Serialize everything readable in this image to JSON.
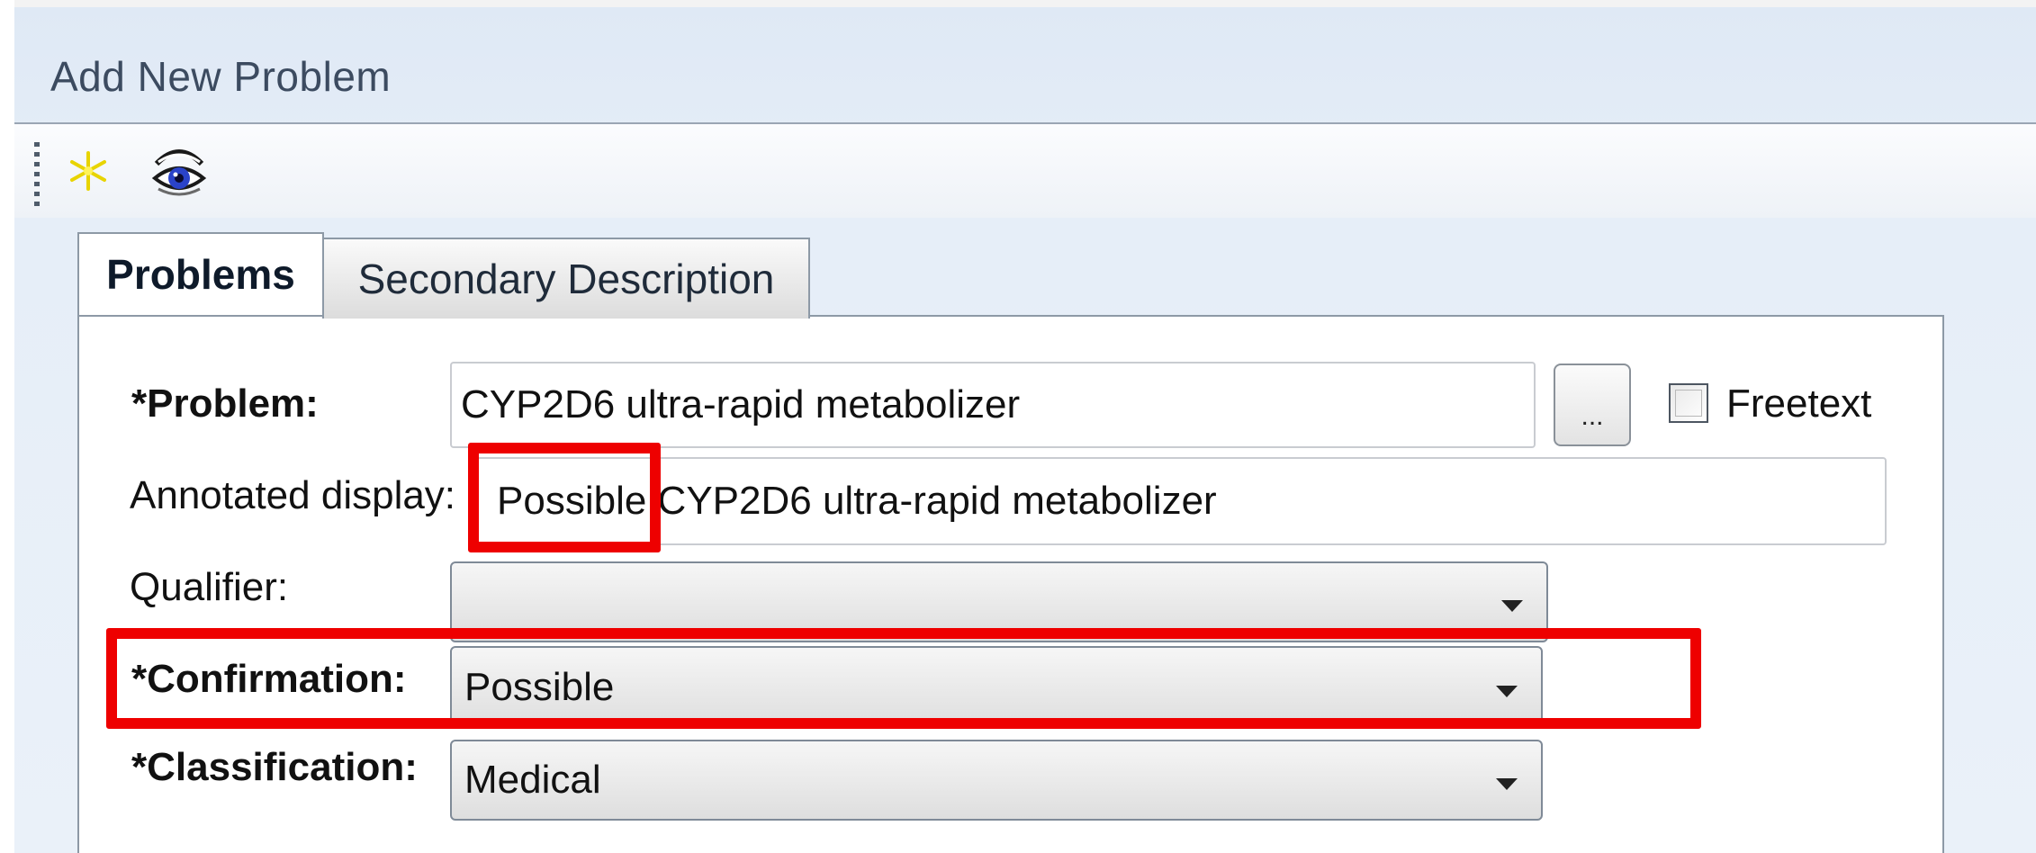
{
  "window": {
    "title": "Add New Problem"
  },
  "toolbar": {
    "items": [
      {
        "icon": "new-star-icon"
      },
      {
        "icon": "eye-view-icon"
      }
    ]
  },
  "tabs": [
    {
      "label": "Problems",
      "active": true
    },
    {
      "label": "Secondary Description",
      "active": false
    }
  ],
  "form": {
    "problem": {
      "label": "*Problem:",
      "value": "CYP2D6 ultra-rapid metabolizer",
      "browse_label": "...",
      "freetext_label": "Freetext",
      "freetext_checked": false
    },
    "annotated": {
      "label": "Annotated display:",
      "prefix": "Possible",
      "rest": " CYP2D6 ultra-rapid metabolizer"
    },
    "qualifier": {
      "label": "Qualifier:",
      "value": ""
    },
    "confirmation": {
      "label": "*Confirmation:",
      "value": "Possible"
    },
    "classification": {
      "label": "*Classification:",
      "value": "Medical"
    }
  },
  "highlight_color": "#ee0000"
}
